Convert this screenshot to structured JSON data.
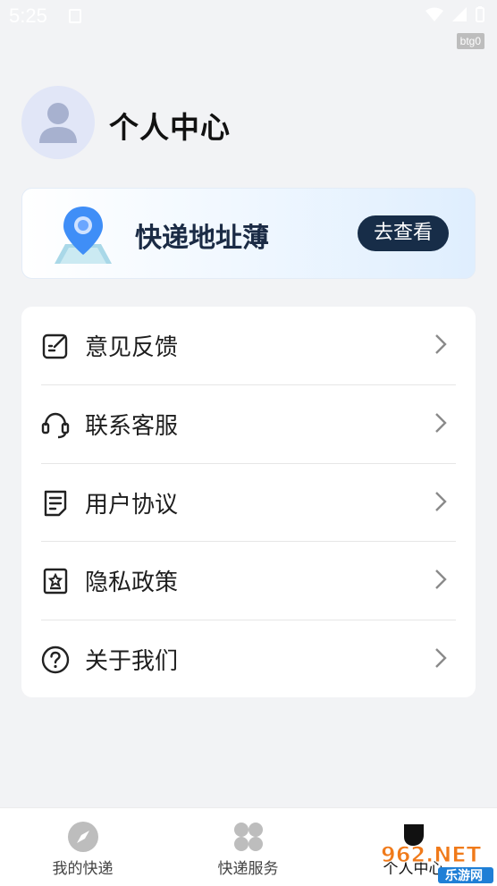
{
  "status_bar": {
    "time": "5:25",
    "badge": "btg0"
  },
  "header": {
    "title": "个人中心"
  },
  "address_card": {
    "title": "快递地址薄",
    "button": "去查看"
  },
  "menu": {
    "items": [
      {
        "label": "意见反馈",
        "icon": "feedback-icon"
      },
      {
        "label": "联系客服",
        "icon": "headset-icon"
      },
      {
        "label": "用户协议",
        "icon": "document-icon"
      },
      {
        "label": "隐私政策",
        "icon": "privacy-icon"
      },
      {
        "label": "关于我们",
        "icon": "question-icon"
      }
    ]
  },
  "tabbar": {
    "tabs": [
      {
        "label": "我的快递",
        "icon": "compass-icon"
      },
      {
        "label": "快递服务",
        "icon": "grid-icon"
      },
      {
        "label": "个人中心",
        "icon": "profile-icon",
        "active": true
      }
    ]
  },
  "watermark": {
    "text": "962.NET",
    "sub": "乐游网"
  },
  "colors": {
    "background": "#f2f3f5",
    "accent_dark": "#172d48",
    "pin_blue": "#3f8ef7"
  }
}
